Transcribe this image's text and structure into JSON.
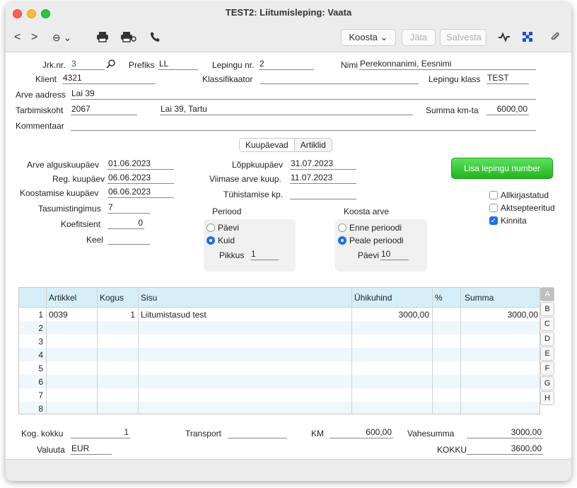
{
  "window": {
    "title": "TEST2: Liitumisleping: Vaata"
  },
  "toolbar": {
    "back": "<",
    "forward": ">",
    "options": "⊖ ⌄",
    "koosta": "Koosta ⌄",
    "jata": "Jäta",
    "salvesta": "Salvesta"
  },
  "header": {
    "jrk_label": "Jrk.nr.",
    "jrk_value": "3",
    "prefiks_label": "Prefiks",
    "prefiks_value": "LL",
    "lepingu_nr_label": "Lepingu nr.",
    "lepingu_nr_value": "2",
    "nimi_label": "Nimi",
    "nimi_value": "Perekonnanimi, Eesnimi",
    "klient_label": "Klient",
    "klient_value": "4321",
    "klassifikaator_label": "Klassifikaator",
    "klassifikaator_value": "",
    "lepingu_klass_label": "Lepingu klass",
    "lepingu_klass_value": "TEST",
    "arve_aadress_label": "Arve aadress",
    "arve_aadress_value": "Lai 39",
    "tarbimiskoht_label": "Tarbimiskoht",
    "tarbimiskoht_value": "2067",
    "tarbimiskoht_address": "Lai 39, Tartu",
    "summa_km_label": "Summa km-ta",
    "summa_km_value": "6000,00",
    "kommentaar_label": "Kommentaar",
    "kommentaar_value": ""
  },
  "tabs": {
    "kuupaevad": "Kuupäevad",
    "artiklid": "Artiklid"
  },
  "dates": {
    "arve_algus_label": "Arve alguskuupäev",
    "arve_algus_value": "01.06.2023",
    "reg_label": "Reg. kuupäev",
    "reg_value": "06.06.2023",
    "koostamise_label": "Koostamise kuupäev",
    "koostamise_value": "06.06.2023",
    "tasumis_label": "Tasumistingimus",
    "tasumis_value": "7",
    "koef_label": "Koefitsient",
    "koef_value": "0",
    "keel_label": "Keel",
    "keel_value": "",
    "lopp_label": "Lõppkuupäev",
    "lopp_value": "31.07.2023",
    "viimase_label": "Viimase arve kuup.",
    "viimase_value": "11.07.2023",
    "tuhist_label": "Tühistamise kp.",
    "tuhist_value": ""
  },
  "actions": {
    "lisa_lepingu_number": "Lisa lepingu number"
  },
  "checkboxes": {
    "allkirjastatud": "Allkirjastatud",
    "aktsepteeritud": "Aktsepteeritud",
    "kinnita": "Kinnita"
  },
  "perood": {
    "title": "Periood",
    "paevi": "Päevi",
    "kuid": "Kuid",
    "pikkus_label": "Pikkus",
    "pikkus_value": "1"
  },
  "koosta_arve": {
    "title": "Koosta arve",
    "enne": "Enne perioodi",
    "peale": "Peale perioodi",
    "paevi_label": "Päevi",
    "paevi_value": "10"
  },
  "grid": {
    "headers": [
      "Artikkel",
      "Kogus",
      "Sisu",
      "Ühikuhind",
      "%",
      "Summa"
    ],
    "rows": [
      {
        "n": "1",
        "artikkel": "0039",
        "kogus": "1",
        "sisu": "Liitumistasud test",
        "uhikuhind": "3000,00",
        "pct": "",
        "summa": "3000,00"
      },
      {
        "n": "2",
        "artikkel": "",
        "kogus": "",
        "sisu": "",
        "uhikuhind": "",
        "pct": "",
        "summa": ""
      },
      {
        "n": "3",
        "artikkel": "",
        "kogus": "",
        "sisu": "",
        "uhikuhind": "",
        "pct": "",
        "summa": ""
      },
      {
        "n": "4",
        "artikkel": "",
        "kogus": "",
        "sisu": "",
        "uhikuhind": "",
        "pct": "",
        "summa": ""
      },
      {
        "n": "5",
        "artikkel": "",
        "kogus": "",
        "sisu": "",
        "uhikuhind": "",
        "pct": "",
        "summa": ""
      },
      {
        "n": "6",
        "artikkel": "",
        "kogus": "",
        "sisu": "",
        "uhikuhind": "",
        "pct": "",
        "summa": ""
      },
      {
        "n": "7",
        "artikkel": "",
        "kogus": "",
        "sisu": "",
        "uhikuhind": "",
        "pct": "",
        "summa": ""
      },
      {
        "n": "8",
        "artikkel": "",
        "kogus": "",
        "sisu": "",
        "uhikuhind": "",
        "pct": "",
        "summa": ""
      }
    ],
    "letters": [
      "A",
      "B",
      "C",
      "D",
      "E",
      "F",
      "G",
      "H"
    ]
  },
  "footer": {
    "kog_label": "Kog. kokku",
    "kog_value": "1",
    "transport_label": "Transport",
    "transport_value": "",
    "km_label": "KM",
    "km_value": "600,00",
    "vahesumma_label": "Vahesumma",
    "vahesumma_value": "3000,00",
    "valuuta_label": "Valuuta",
    "valuuta_value": "EUR",
    "kokku_label": "KOKKU",
    "kokku_value": "3600,00"
  },
  "icons": [
    "print-icon",
    "print-preview-icon",
    "phone-icon",
    "activity-icon",
    "connect-icon",
    "attachment-icon",
    "search-icon"
  ]
}
